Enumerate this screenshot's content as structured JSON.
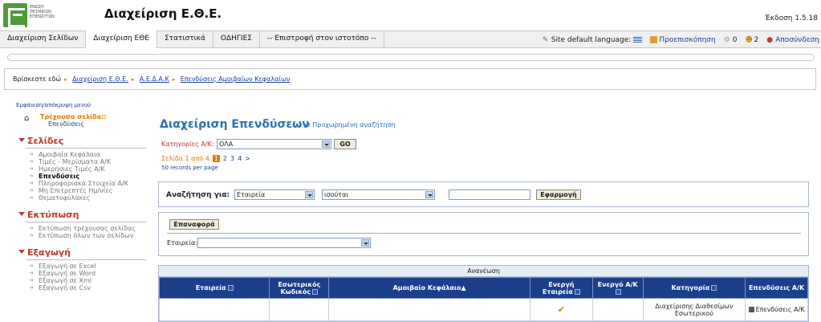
{
  "header": {
    "logo_text": "ΕΝΩΣΗ ΘΕΣΜΙΚΩΝ ΕΠΕΝΔΥΤΩΝ",
    "app_title": "Διαχείριση Ε.Θ.Ε.",
    "version": "Έκδοση 1.5.18"
  },
  "nav": {
    "tabs": [
      {
        "label": "Διαχείριση Σελίδων"
      },
      {
        "label": "Διαχείριση ΕΘΕ"
      },
      {
        "label": "Στατιστικά"
      },
      {
        "label": "ΟΔΗΓΙΕΣ"
      },
      {
        "label": "-- Επιστροφή στον ιστοτόπο --"
      }
    ],
    "language_label": "Site default language:",
    "preview_label": "Προεπισκόπηση",
    "count_a": "0",
    "count_b": "2",
    "logout_label": "Αποσύνδεση"
  },
  "breadcrumb": {
    "prefix": "Βρίσκεστε εδώ",
    "items": [
      "Διαχείριση Ε.Θ.Ε.",
      "Α.Ε.Δ.Α.Κ",
      "Επενδύσεις Αμοιβαίων Κεφαλαίων"
    ]
  },
  "sidebar": {
    "toggle": "Εμφάνιση/απόκρυψη μενού",
    "current_label": "Τρέχουσα σελίδα::",
    "current_page": "Επενδύσεις",
    "sections": [
      {
        "title": "Σελίδες",
        "items": [
          "Αμοιβαία Κεφάλαια",
          "Τιμές - Μερίσματα Α/Κ",
          "Ημερήσιες Τιμές Α/Κ",
          "Επενδύσεις",
          "Πληροφοριακά Στοιχεία Α/Κ",
          "Μη Επιτρεπτές Ημ/νίες",
          "Θεματοφύλακες"
        ]
      },
      {
        "title": "Εκτύπωση",
        "items": [
          "Εκτύπωση τρέχουσας σελίδας",
          "Εκτύπωση όλων των σελίδων"
        ]
      },
      {
        "title": "Εξαγωγή",
        "items": [
          "Εξαγωγή σε Excel",
          "Εξαγωγή σε Word",
          "Εξαγωγή σε Xml",
          "Εξαγωγή σε Csv"
        ]
      }
    ]
  },
  "main": {
    "title": "Διαχείριση Επενδύσεων",
    "advanced_search": "Προχωρημένη αναζήτηση",
    "category_label": "Κατηγορίες Α/Κ:",
    "category_value": "ΟΛΑ",
    "go_label": "GO",
    "page_text": "Σελίδα 1 από 4",
    "pages": [
      "1",
      "2",
      "3",
      "4",
      ">"
    ],
    "records": "50 records per page"
  },
  "search": {
    "label": "Αναζήτηση για:",
    "field_value": "Εταιρεία",
    "op_value": "ισούται",
    "text_value": "",
    "apply_label": "Εφαρμογή"
  },
  "filter": {
    "reset_label": "Επαναφορά",
    "company_label": "Εταιρεία:",
    "company_value": ""
  },
  "grid": {
    "refresh_label": "Ανανέωση",
    "columns": [
      "Εταιρεία",
      "Εσωτερικός Κωδικός",
      "Αμοιβαίο Κεφάλαιο",
      "Ενεργή Εταιρεία",
      "Ενεργό Α/Κ",
      "Κατηγορία",
      "Επενδύσεις Α/Κ"
    ],
    "rows": [
      {
        "company": "",
        "code": "",
        "fund": "",
        "active_company": "✔",
        "active_fund": "",
        "category": "Διαχείρισης Διαθεσίμων Εσωτερικού",
        "investments": "Επενδύσεις Α/Κ"
      }
    ]
  },
  "colors": {
    "nav_blue": "#1c3f8b",
    "accent_orange": "#e07a00",
    "title_blue": "#2d6fb7",
    "section_red": "#c0392b"
  }
}
